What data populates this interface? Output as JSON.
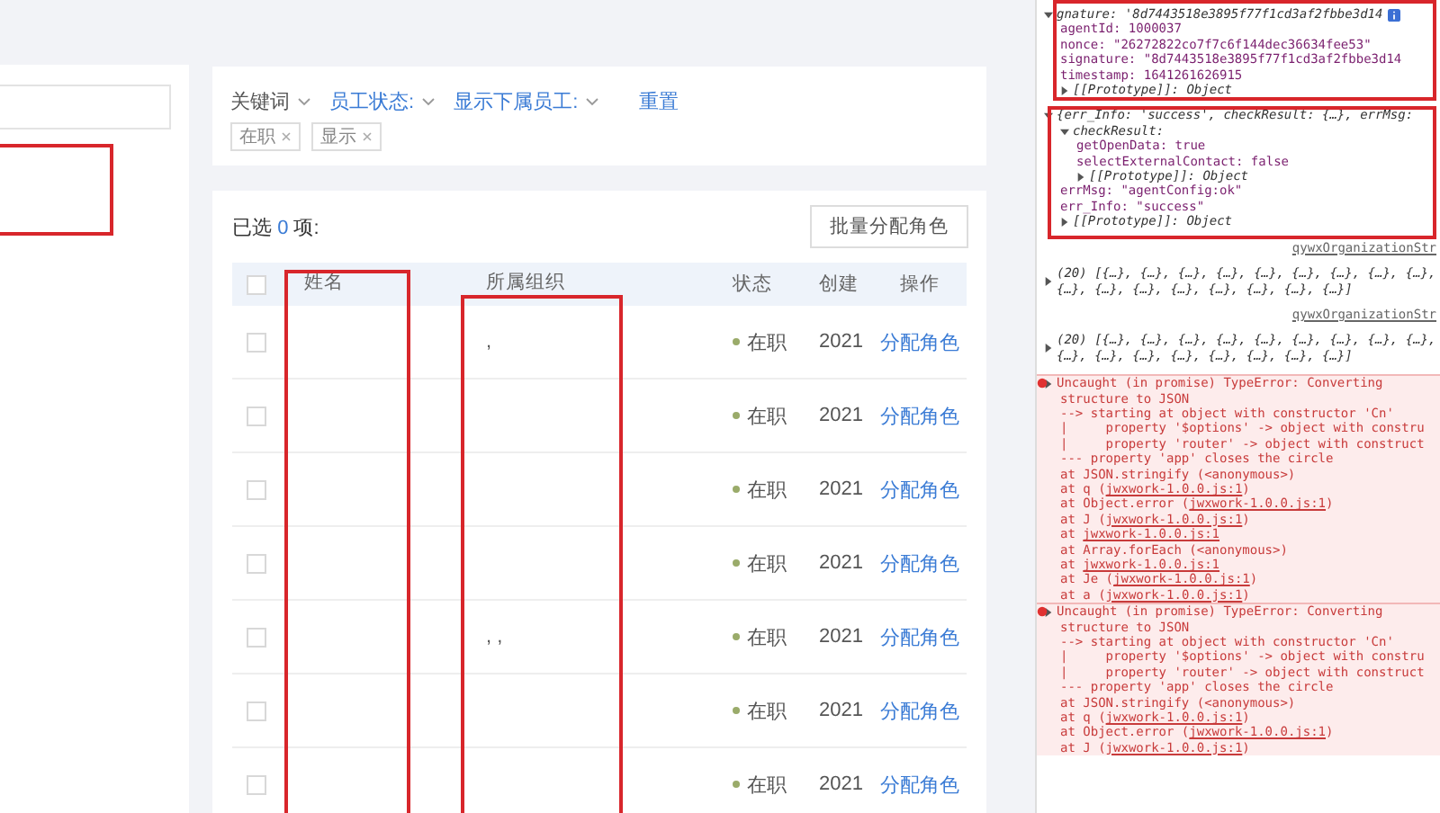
{
  "filters": [
    {
      "label": "关键词",
      "kind": "plain"
    },
    {
      "label": "员工状态:",
      "kind": "link"
    },
    {
      "label": "显示下属员工:",
      "kind": "link"
    }
  ],
  "reset": "重置",
  "tags": [
    "在职",
    "显示"
  ],
  "selection": {
    "prefix": "已选",
    "count": "0",
    "suffix": "项:"
  },
  "batch_button": "批量分配角色",
  "table": {
    "columns": [
      "姓名",
      "所属组织",
      "状态",
      "创建",
      "操作"
    ],
    "header_checked": false,
    "rows": [
      {
        "checked": false,
        "org": ",",
        "status": "在职",
        "created": "2021",
        "action": "分配角色"
      },
      {
        "checked": false,
        "org": "",
        "status": "在职",
        "created": "2021",
        "action": "分配角色"
      },
      {
        "checked": false,
        "org": "",
        "status": "在职",
        "created": "2021",
        "action": "分配角色"
      },
      {
        "checked": false,
        "org": "",
        "status": "在职",
        "created": "2021",
        "action": "分配角色"
      },
      {
        "checked": false,
        "org": ", ,",
        "status": "在职",
        "created": "2021",
        "action": "分配角色"
      },
      {
        "checked": false,
        "org": "",
        "status": "在职",
        "created": "2021",
        "action": "分配角色"
      },
      {
        "checked": false,
        "org": "",
        "status": "在职",
        "created": "2021",
        "action": "分配角色"
      }
    ]
  },
  "console": [
    {
      "kind": "object",
      "text": "gnature: '8d7443518e3895f77f1cd3af2fbbe3d14",
      "expanded": true,
      "info": true,
      "children": [
        {
          "kind": "prop",
          "text": "agentId: 1000037"
        },
        {
          "kind": "prop",
          "text": "nonce: \"26272822co7f7c6f144dec36634fee53\""
        },
        {
          "kind": "prop",
          "text": "signature: \"8d7443518e3895f77f1cd3af2fbbe3d14"
        },
        {
          "kind": "prop",
          "text": "timestamp: 1641261626915"
        },
        {
          "kind": "object",
          "text": "[[Prototype]]: Object",
          "expanded": false
        }
      ]
    },
    {
      "kind": "object",
      "text": "{err_Info: 'success', checkResult: {…}, errMsg:",
      "expanded": true,
      "children": [
        {
          "kind": "object",
          "text": "checkResult:",
          "expanded": true,
          "children": [
            {
              "kind": "prop",
              "text": "getOpenData: true"
            },
            {
              "kind": "prop",
              "text": "selectExternalContact: false"
            },
            {
              "kind": "object",
              "text": "[[Prototype]]: Object",
              "expanded": false
            }
          ]
        },
        {
          "kind": "prop",
          "text": "errMsg: \"agentConfig:ok\""
        },
        {
          "kind": "prop",
          "text": "err_Info: \"success\""
        },
        {
          "kind": "object",
          "text": "[[Prototype]]: Object",
          "expanded": false
        }
      ]
    },
    {
      "kind": "source",
      "text": "qywxOrganizationStr"
    },
    {
      "kind": "object",
      "text": "(20) [{…}, {…}, {…}, {…}, {…}, {…}, {…}, {…}, {…}, {…}, {…}, {…}, {…}, {…}, {…}, {…}, {…}]",
      "expanded": false
    },
    {
      "kind": "source",
      "text": "qywxOrganizationStr"
    },
    {
      "kind": "object",
      "text": "(20) [{…}, {…}, {…}, {…}, {…}, {…}, {…}, {…}, {…}, {…}, {…}, {…}, {…}, {…}, {…}, {…}, {…}]",
      "expanded": false
    },
    {
      "kind": "error",
      "text": "Uncaught (in promise) TypeError: Converting",
      "children": [
        {
          "kind": "plain",
          "text": "structure to JSON"
        },
        {
          "kind": "trace",
          "text": "--> starting at object with constructor 'Cn'"
        },
        {
          "kind": "trace",
          "text": "|     property '$options' -> object with constru"
        },
        {
          "kind": "trace",
          "text": "|     property 'router' -> object with construct"
        },
        {
          "kind": "trace",
          "text": "--- property 'app' closes the circle"
        },
        {
          "kind": "trace",
          "text": "at JSON.stringify (<anonymous>)"
        },
        {
          "kind": "trace",
          "text": "at q (",
          "link": "jwxwork-1.0.0.js:1",
          "after": ")"
        },
        {
          "kind": "trace",
          "text": "at Object.error (",
          "link": "jwxwork-1.0.0.js:1",
          "after": ")"
        },
        {
          "kind": "trace",
          "text": "at J (",
          "link": "jwxwork-1.0.0.js:1",
          "after": ")"
        },
        {
          "kind": "trace",
          "text": "at ",
          "link": "jwxwork-1.0.0.js:1"
        },
        {
          "kind": "trace",
          "text": "at Array.forEach (<anonymous>)"
        },
        {
          "kind": "trace",
          "text": "at ",
          "link": "jwxwork-1.0.0.js:1"
        },
        {
          "kind": "trace",
          "text": "at Je (",
          "link": "jwxwork-1.0.0.js:1",
          "after": ")"
        },
        {
          "kind": "trace",
          "text": "at a (",
          "link": "jwxwork-1.0.0.js:1",
          "after": ")"
        }
      ]
    },
    {
      "kind": "error",
      "text": "Uncaught (in promise) TypeError: Converting",
      "children": [
        {
          "kind": "plain",
          "text": "structure to JSON"
        },
        {
          "kind": "trace",
          "text": "--> starting at object with constructor 'Cn'"
        },
        {
          "kind": "trace",
          "text": "|     property '$options' -> object with constru"
        },
        {
          "kind": "trace",
          "text": "|     property 'router' -> object with construct"
        },
        {
          "kind": "trace",
          "text": "--- property 'app' closes the circle"
        },
        {
          "kind": "trace",
          "text": "at JSON.stringify (<anonymous>)"
        },
        {
          "kind": "trace",
          "text": "at q (",
          "link": "jwxwork-1.0.0.js:1",
          "after": ")"
        },
        {
          "kind": "trace",
          "text": "at Object.error (",
          "link": "jwxwork-1.0.0.js:1",
          "after": ")"
        },
        {
          "kind": "trace",
          "text": "at J (",
          "link": "jwxwork-1.0.0.js:1",
          "after": ")"
        }
      ]
    }
  ]
}
